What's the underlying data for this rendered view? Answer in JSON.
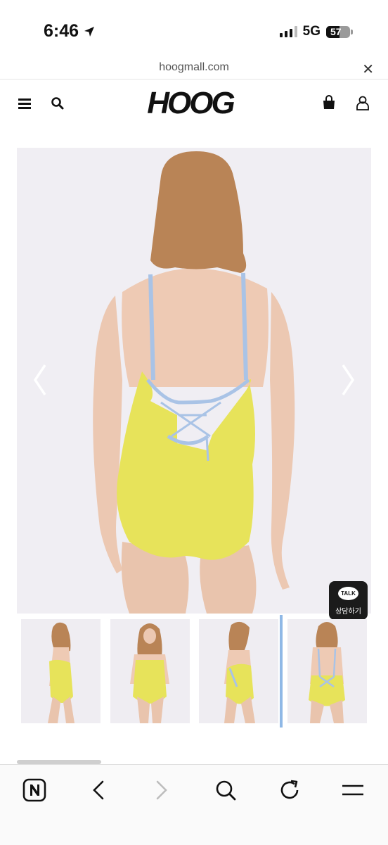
{
  "status_bar": {
    "time": "6:46",
    "network": "5G",
    "battery": "57"
  },
  "browser": {
    "url": "hoogmall.com"
  },
  "site": {
    "logo_text": "HOOG"
  },
  "chat": {
    "bubble": "TALK",
    "label": "상담하기"
  },
  "colors": {
    "swimsuit": "#e7e35a",
    "strap": "#a9c3e6",
    "selection": "#8fb8e6"
  },
  "icons": [
    "location-arrow-icon",
    "hamburger-menu-icon",
    "search-icon",
    "shopping-bag-icon",
    "user-icon",
    "close-icon",
    "chevron-left-icon",
    "chevron-right-icon",
    "naver-icon",
    "back-icon",
    "forward-icon",
    "refresh-icon",
    "menu-icon"
  ]
}
